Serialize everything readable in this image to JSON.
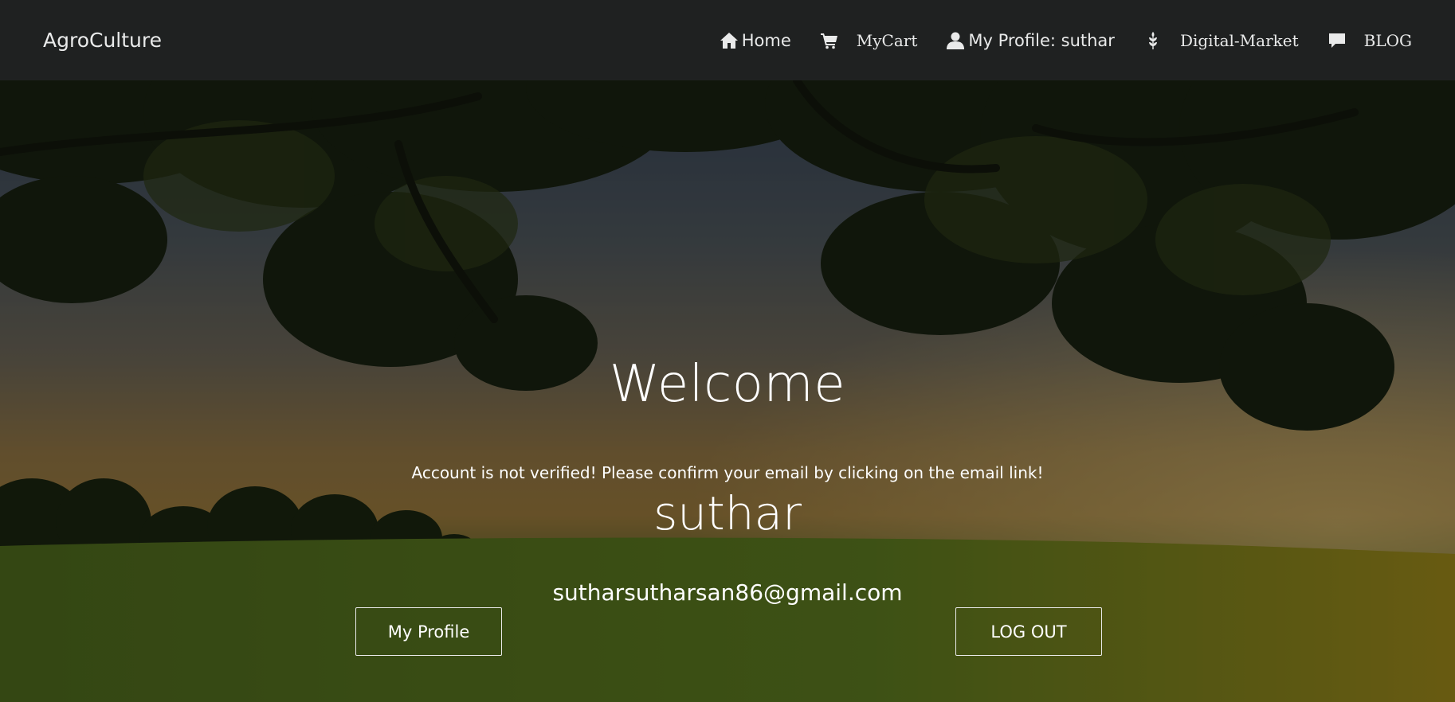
{
  "nav": {
    "brand": "AgroCulture",
    "items": [
      {
        "label": "Home",
        "icon": "home-icon"
      },
      {
        "label": "MyCart",
        "icon": "cart-icon"
      },
      {
        "label": "My Profile: suthar",
        "icon": "user-icon"
      },
      {
        "label": "Digital-Market",
        "icon": "leaf-icon"
      },
      {
        "label": "BLOG",
        "icon": "comment-icon"
      }
    ]
  },
  "hero": {
    "title": "Welcome",
    "notice": "Account is not verified! Please confirm your email by clicking on the email link!",
    "username": "suthar",
    "email": "sutharsutharsan86@gmail.com",
    "buttons": {
      "profile": "My Profile",
      "logout": "LOG OUT"
    }
  },
  "colors": {
    "navbar_bg": "#1f2121",
    "text_light": "#e9eaea"
  }
}
